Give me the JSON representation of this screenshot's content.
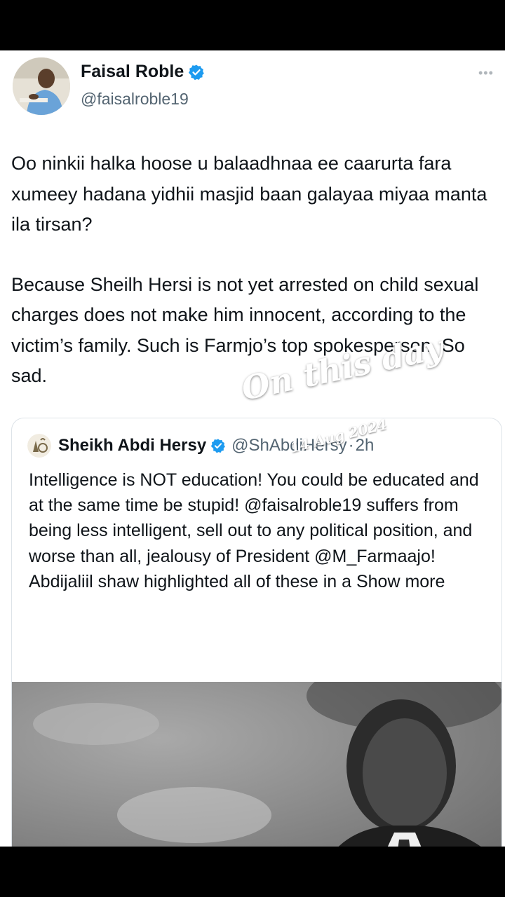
{
  "author": {
    "name": "Faisal Roble",
    "handle": "@faisalroble19",
    "more_icon": "•••"
  },
  "tweet": {
    "paragraph_1": "Oo ninkii halka hoose u balaadhnaa ee caarurta fara  xumeey hadana yidhii masjid baan galayaa miyaa manta ila tirsan?",
    "paragraph_2": "Because Sheilh Hersi is not yet arrested on child sexual charges does not make him innocent, according to the victim’s family. Such is Farmjo’s top spokesperson. So sad."
  },
  "quoted": {
    "name": "Sheikh Abdi Hersy",
    "handle": "@ShAbdiHersy",
    "separator": "·",
    "time": "2h",
    "text": "Intelligence is NOT education! You could be educated and at the same time be stupid! @faisalroble19 suffers from being less intelligent, sell out to any political position, and worse than all, jealousy of President @M_Farmaajo! Abdijaliil shaw highlighted all of these in a Show more"
  },
  "overlay": {
    "title": "On this day",
    "date": "14 Aug 2024"
  },
  "colors": {
    "verified": "#1d9bf0",
    "text": "#0f1419",
    "secondary": "#536471"
  }
}
